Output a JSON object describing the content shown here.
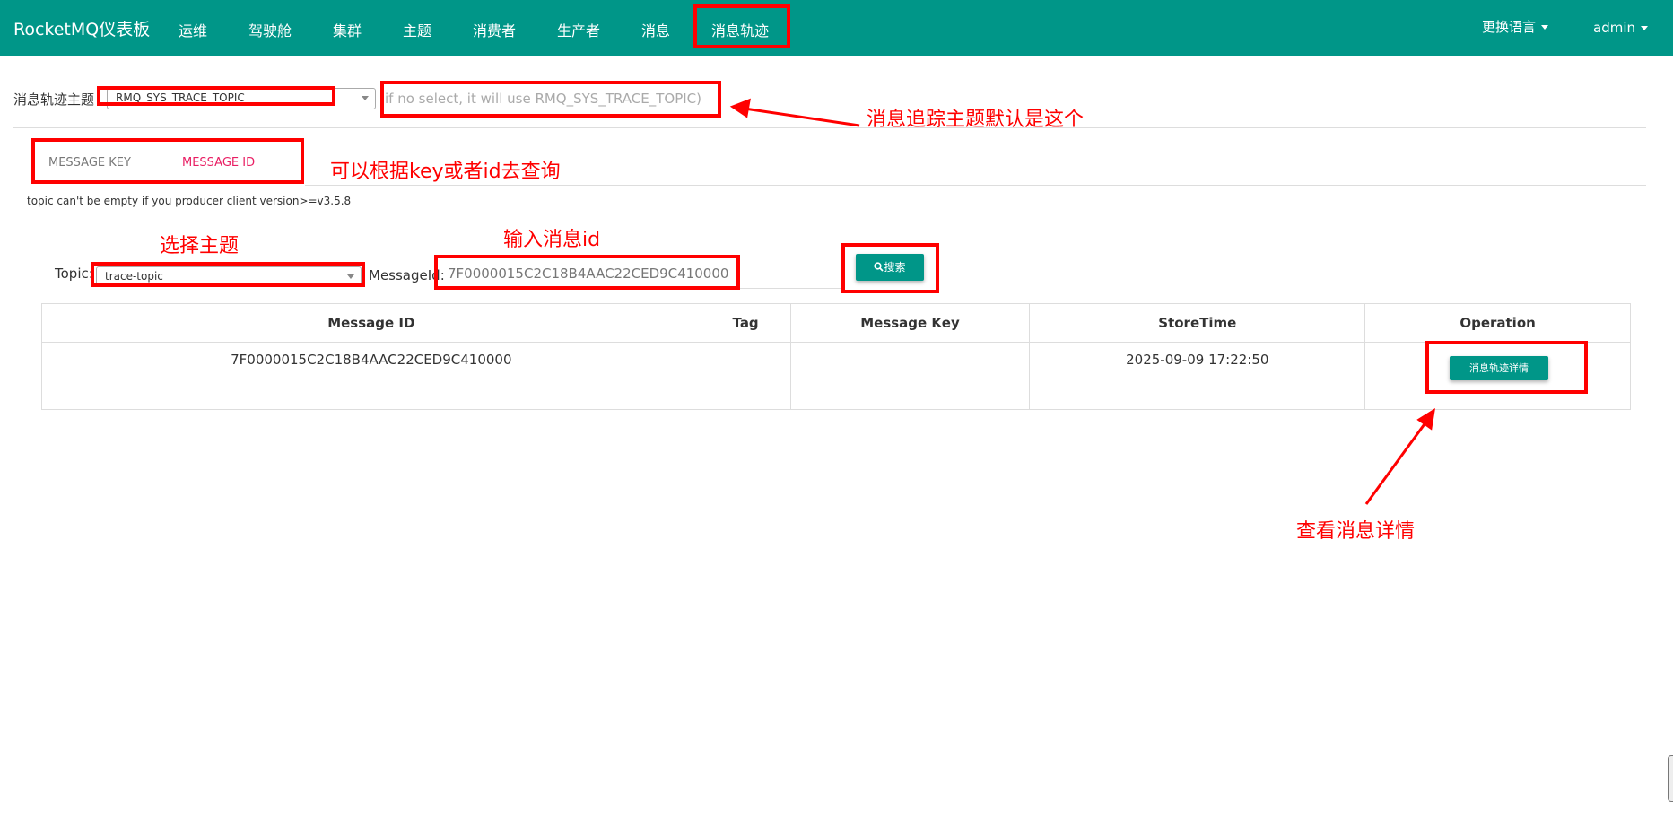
{
  "nav": {
    "brand": "RocketMQ仪表板",
    "items": [
      "运维",
      "驾驶舱",
      "集群",
      "主题",
      "消费者",
      "生产者",
      "消息",
      "消息轨迹"
    ],
    "language": "更换语言",
    "user": "admin"
  },
  "trace": {
    "label": "消息轨迹主题",
    "selected": "RMQ_SYS_TRACE_TOPIC",
    "hint": "if no select, it will use RMQ_SYS_TRACE_TOPIC)"
  },
  "tabs": {
    "key": "MESSAGE KEY",
    "id": "MESSAGE ID"
  },
  "notice": "topic can't be empty if you producer client version>=v3.5.8",
  "form": {
    "topic_label": "Topic:",
    "topic_value": "trace-topic",
    "msgid_label": "MessageId:",
    "msgid_value": "7F0000015C2C18B4AAC22CED9C410000",
    "search": "搜索"
  },
  "table": {
    "headers": [
      "Message ID",
      "Tag",
      "Message Key",
      "StoreTime",
      "Operation"
    ],
    "rows": [
      {
        "id": "7F0000015C2C18B4AAC22CED9C410000",
        "tag": "",
        "key": "",
        "time": "2025-09-09 17:22:50",
        "op": "消息轨迹详情"
      }
    ]
  },
  "annotations": {
    "trace_default": "消息追踪主题默认是这个",
    "query_by": "可以根据key或者id去查询",
    "select_topic": "选择主题",
    "input_id": "输入消息id",
    "view_detail": "查看消息详情"
  },
  "colors": {
    "primary": "#009688",
    "annotation": "#ff0000",
    "active_tab": "#e91e63"
  }
}
